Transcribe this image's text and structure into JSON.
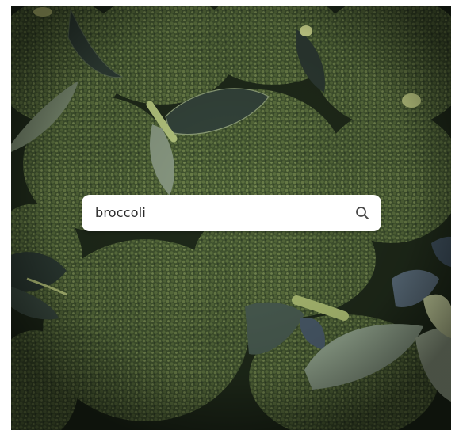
{
  "search": {
    "value": "broccoli",
    "icon": "magnifier-icon"
  },
  "photo": {
    "subject_colors": {
      "floret_dark": "#2c3a24",
      "floret_mid": "#4f6235",
      "floret_light": "#6f8048",
      "leaf": "#3b4a3f",
      "stem": "#b9c98a"
    }
  }
}
